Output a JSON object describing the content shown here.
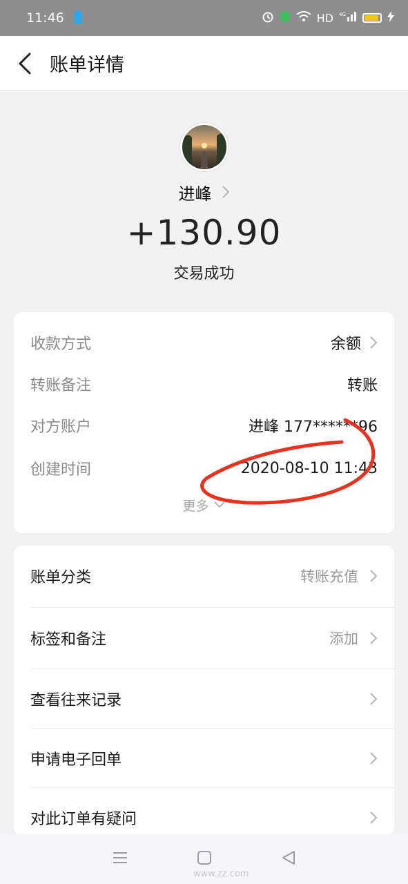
{
  "status_bar": {
    "time": "11:46",
    "network": "HD",
    "signal": "4G"
  },
  "header": {
    "title": "账单详情"
  },
  "transaction": {
    "payee": "进峰",
    "amount": "+130.90",
    "status": "交易成功"
  },
  "details": [
    {
      "label": "收款方式",
      "value": "余额"
    },
    {
      "label": "转账备注",
      "value": "转账"
    },
    {
      "label": "对方账户",
      "value": "进峰 177******96"
    },
    {
      "label": "创建时间",
      "value": "2020-08-10 11:43"
    }
  ],
  "more_label": "更多",
  "actions": [
    {
      "label": "账单分类",
      "value": "转账充值"
    },
    {
      "label": "标签和备注",
      "value": "添加"
    },
    {
      "label": "查看往来记录",
      "value": ""
    },
    {
      "label": "申请电子回单",
      "value": ""
    },
    {
      "label": "对此订单有疑问",
      "value": ""
    }
  ],
  "watermark": "www.zz.com",
  "colors": {
    "annotation": "#e8321e",
    "battery": "#f5c518"
  }
}
